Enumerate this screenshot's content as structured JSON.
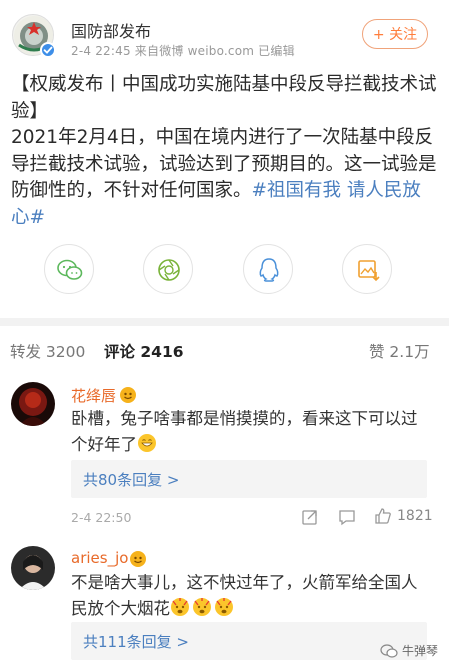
{
  "post": {
    "author": "国防部发布",
    "time_source": "2-4 22:45  来自微博 weibo.com  已编辑",
    "follow_label": "+ 关注",
    "title": "【权威发布丨中国成功实施陆基中段反导拦截技术试验】",
    "text": "2021年2月4日，中国在境内进行了一次陆基中段反导拦截技术试验，试验达到了预期目的。这一试验是防御性的，不针对任何国家。",
    "hashtag": "#祖国有我 请人民放心#"
  },
  "share": {
    "icons": [
      "wechat-icon",
      "moments-icon",
      "qq-icon",
      "save-image-icon"
    ]
  },
  "tabs": {
    "repost": "转发 3200",
    "comments": "评论 2416",
    "likes": "赞 2.1万"
  },
  "comments": [
    {
      "name": "花绛唇",
      "text": "卧槽，兔子啥事都是悄摸摸的，看来这下可以过个好年了",
      "replies": "共80条回复 >",
      "time": "2-4 22:50",
      "likes": "1821"
    },
    {
      "name": "aries_jo",
      "text": "不是啥大事儿，这不快过年了，火箭军给全国人民放个大烟花",
      "replies": "共111条回复 >"
    }
  ],
  "watermark": "牛弹琴",
  "colors": {
    "accent_orange": "#ff7d3b",
    "link_blue": "#4b7fbf",
    "verified_blue": "#3d8ee8"
  }
}
